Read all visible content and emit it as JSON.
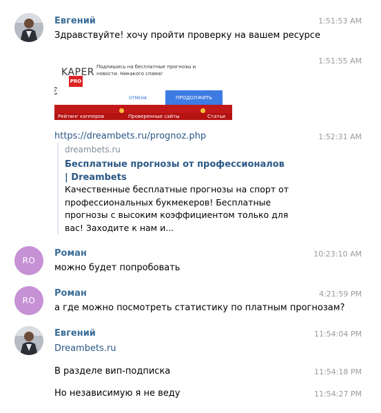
{
  "top_fragment": "• ••• ••",
  "messages": [
    {
      "sender": "Евгений",
      "time": "1:51:53 AM",
      "text": "Здравствуйте! хочу пройти проверку на вашем ресурсе"
    },
    {
      "time": "1:51:55 AM",
      "preview": {
        "logo": "KAPER",
        "logo_badge": "PRO",
        "text": "Подпишись на бесплатные прогнозы и новости. Никакого спама!",
        "cancel": "ОТМЕНА",
        "continue": "ПРОДОЛЖИТЬ",
        "nav": [
          "Рейтинг капперов",
          "Проверенные сайты",
          "Статьи"
        ]
      }
    },
    {
      "time": "1:52:31 AM",
      "link": "https://dreambets.ru/prognoz.php",
      "card": {
        "site": "dreambets.ru",
        "title": "Бесплатные прогнозы от профессионалов | Dreambets",
        "description": "Качественные бесплатные прогнозы на спорт от профессиональных букмекеров! Бесплатные прогнозы с высоким коэффициентом только для вас! Заходите к нам и..."
      }
    },
    {
      "sender": "Роман",
      "initials": "RO",
      "time": "10:23:10 AM",
      "text": "можно будет попробовать"
    },
    {
      "sender": "Роман",
      "initials": "RO",
      "time": "4:21:59 PM",
      "text": "а где можно посмотреть статистику по платным прогнозам?"
    },
    {
      "sender": "Евгений",
      "time": "11:54:04 PM",
      "link": "Dreambets.ru"
    },
    {
      "time": "11:54:18 PM",
      "text": "В разделе вип-подписка"
    },
    {
      "time": "11:54:27 PM",
      "text": "Но независимую я не веду"
    }
  ],
  "colors": {
    "sender": "#3a6d99",
    "link": "#2a5885",
    "avatar_initials_bg": "#c791d6",
    "time": "#999999"
  }
}
